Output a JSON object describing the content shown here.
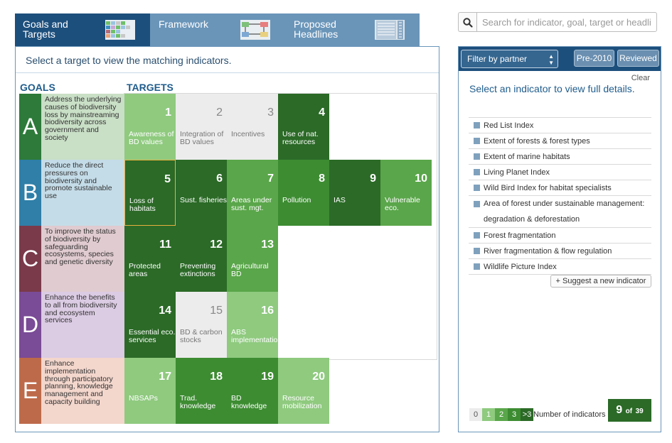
{
  "tabs": [
    {
      "label": "Goals and Targets",
      "active": true
    },
    {
      "label": "Framework",
      "active": false
    },
    {
      "label": "Proposed Headlines",
      "active": false
    }
  ],
  "instructions": "Select a target to view the matching indicators.",
  "columns": {
    "goals": "GOALS",
    "targets": "TARGETS"
  },
  "goals": [
    {
      "letter": "A",
      "color": "#2d7a3a",
      "bg": "#c9dfc6",
      "text": "Address the underlying causes of biodiversity loss by mainstreaming biodiversity across government and society"
    },
    {
      "letter": "B",
      "color": "#2f7fa8",
      "bg": "#c4dce8",
      "text": "Reduce the direct pressures on biodiversity and promote sustainable use"
    },
    {
      "letter": "C",
      "color": "#7a3a4a",
      "bg": "#e0cbd0",
      "text": "To improve the status of biodiversity by safeguarding ecosystems, species and genetic diversity"
    },
    {
      "letter": "D",
      "color": "#7a4b96",
      "bg": "#dbcbe3",
      "text": "Enhance the benefits to all from biodiversity and ecosystem services"
    },
    {
      "letter": "E",
      "color": "#bd6a4a",
      "bg": "#f3d6cc",
      "text": "Enhance implementation through participatory planning, knowledge management and capacity building"
    }
  ],
  "targets": [
    {
      "num": "1",
      "label": "Awareness of BD values",
      "level": "pale",
      "row": 0,
      "col": 0
    },
    {
      "num": "2",
      "label": "Integration of BD values",
      "level": "gray",
      "row": 0,
      "col": 1
    },
    {
      "num": "3",
      "label": "Incentives",
      "level": "gray",
      "row": 0,
      "col": 2
    },
    {
      "num": "4",
      "label": "Use of nat. resources",
      "level": "dark",
      "row": 0,
      "col": 3
    },
    {
      "num": "5",
      "label": "Loss of habitats",
      "level": "dark",
      "row": 1,
      "col": 0,
      "selected": true
    },
    {
      "num": "6",
      "label": "Sust. fisheries",
      "level": "dark",
      "row": 1,
      "col": 1
    },
    {
      "num": "7",
      "label": "Areas under sust. mgt.",
      "level": "light",
      "row": 1,
      "col": 2
    },
    {
      "num": "8",
      "label": "Pollution",
      "level": "mid",
      "row": 1,
      "col": 3
    },
    {
      "num": "9",
      "label": "IAS",
      "level": "dark",
      "row": 1,
      "col": 4
    },
    {
      "num": "10",
      "label": "Vulnerable eco.",
      "level": "light",
      "row": 1,
      "col": 5
    },
    {
      "num": "11",
      "label": "Protected areas",
      "level": "dark",
      "row": 2,
      "col": 0
    },
    {
      "num": "12",
      "label": "Preventing extinctions",
      "level": "dark",
      "row": 2,
      "col": 1
    },
    {
      "num": "13",
      "label": "Agricultural BD",
      "level": "light",
      "row": 2,
      "col": 2
    },
    {
      "num": "14",
      "label": "Essential eco. services",
      "level": "dark",
      "row": 3,
      "col": 0
    },
    {
      "num": "15",
      "label": "BD & carbon stocks",
      "level": "gray",
      "row": 3,
      "col": 1
    },
    {
      "num": "16",
      "label": "ABS implementation",
      "level": "pale",
      "row": 3,
      "col": 2
    },
    {
      "num": "17",
      "label": "NBSAPs",
      "level": "pale",
      "row": 4,
      "col": 0
    },
    {
      "num": "18",
      "label": "Trad. knowledge",
      "level": "mid",
      "row": 4,
      "col": 1
    },
    {
      "num": "19",
      "label": "BD knowledge",
      "level": "mid",
      "row": 4,
      "col": 2
    },
    {
      "num": "20",
      "label": "Resource mobilization",
      "level": "pale",
      "row": 4,
      "col": 3
    }
  ],
  "search": {
    "placeholder": "Search for indicator, goal, target or headline",
    "value": ""
  },
  "filter": {
    "label": "Filter by partner"
  },
  "buttons": {
    "pre2010": "Pre-2010",
    "reviewed": "Reviewed",
    "clear": "Clear",
    "suggest": "+ Suggest a new indicator"
  },
  "indicator_heading": "Select an indicator to view full details.",
  "indicators": [
    "Red List Index",
    "Extent of forests & forest types",
    "Extent of marine habitats",
    "Living Planet Index",
    "Wild Bird Index for habitat specialists",
    "Area of forest under sustainable management: degradation & deforestation",
    "Forest fragmentation",
    "River fragmentation & flow regulation",
    "Wildlife Picture Index"
  ],
  "legend": {
    "items": [
      {
        "label": "0",
        "color": "#ececec"
      },
      {
        "label": "1",
        "color": "#8fca7f"
      },
      {
        "label": "2",
        "color": "#5aa64a"
      },
      {
        "label": "3",
        "color": "#3d8c32"
      },
      {
        "label": ">3",
        "color": "#2b6a27"
      }
    ],
    "label": "Number of indicators"
  },
  "count": {
    "shown": "9",
    "of_label": "of",
    "total": "39"
  },
  "icons": {
    "search": "search-icon",
    "select_arrows": "select-arrows-icon"
  }
}
